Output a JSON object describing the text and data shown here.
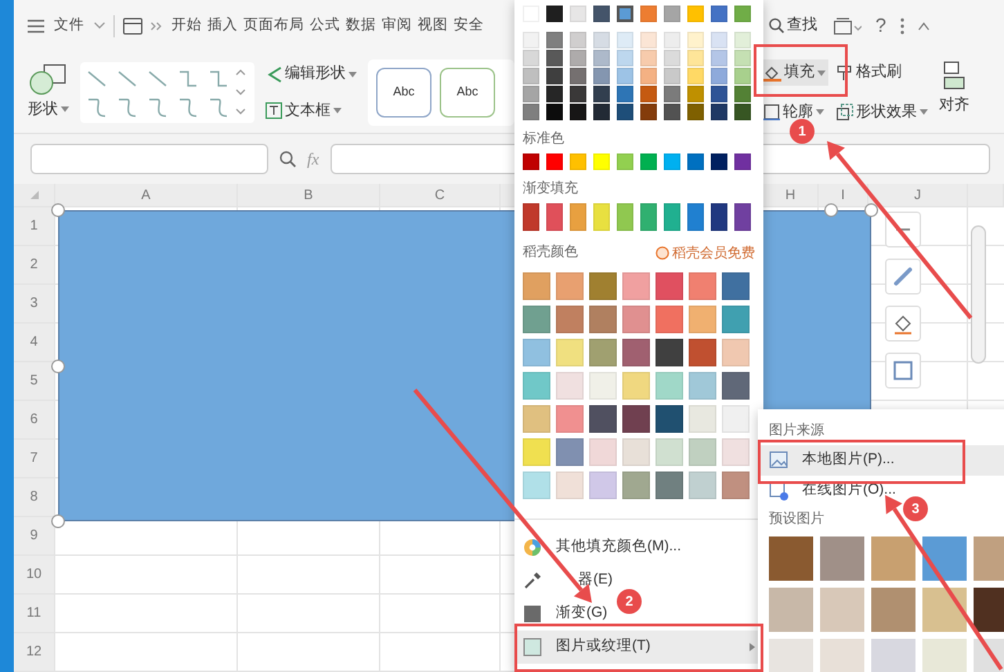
{
  "title_bar": {
    "menu_label": "文件",
    "tabs": [
      "开始",
      "插入",
      "页面布局",
      "公式",
      "数据",
      "审阅",
      "视图",
      "安全"
    ],
    "search_label": "查找",
    "help_label": "?"
  },
  "ribbon": {
    "shape_label": "形状",
    "edit_shape_label": "编辑形状",
    "text_box_label": "文本框",
    "style_presets": [
      "Abc",
      "Abc"
    ],
    "fill_label": "填充",
    "format_painter_label": "格式刷",
    "outline_label": "轮廓",
    "shape_effect_label": "形状效果",
    "align_label": "对齐"
  },
  "formula_bar": {
    "fx_label": "fx"
  },
  "sheet": {
    "columns": [
      "A",
      "B",
      "C",
      "H",
      "I",
      "J"
    ],
    "rows": [
      "1",
      "2",
      "3",
      "4",
      "5",
      "6",
      "7",
      "8",
      "9",
      "10",
      "11",
      "12"
    ]
  },
  "fill_menu": {
    "theme_colors": [
      {
        "color": "#ffffff",
        "selected": false
      },
      {
        "color": "#1f1f1f",
        "selected": false
      },
      {
        "color": "#e7e6e6",
        "selected": false
      },
      {
        "color": "#44546a",
        "selected": false
      },
      {
        "color": "#5b9bd5",
        "selected": true
      },
      {
        "color": "#ed7d31",
        "selected": false
      },
      {
        "color": "#a5a5a5",
        "selected": false
      },
      {
        "color": "#ffc000",
        "selected": false
      },
      {
        "color": "#4472c4",
        "selected": false
      },
      {
        "color": "#70ad47",
        "selected": false
      }
    ],
    "shade_rows": [
      [
        {
          "color": "#f2f2f2"
        },
        {
          "color": "#7f7f7f"
        },
        {
          "color": "#d0cece"
        },
        {
          "color": "#d6dce4"
        },
        {
          "color": "#deebf6"
        },
        {
          "color": "#fbe5d5"
        },
        {
          "color": "#ededed"
        },
        {
          "color": "#fff2cc"
        },
        {
          "color": "#d9e2f3"
        },
        {
          "color": "#e2efd9"
        }
      ],
      [
        {
          "color": "#d8d8d8"
        },
        {
          "color": "#595959"
        },
        {
          "color": "#aeabab"
        },
        {
          "color": "#adb9ca"
        },
        {
          "color": "#bdd7ee"
        },
        {
          "color": "#f7cbac"
        },
        {
          "color": "#dbdbdb"
        },
        {
          "color": "#fee599"
        },
        {
          "color": "#b4c6e7"
        },
        {
          "color": "#c5e0b3"
        }
      ],
      [
        {
          "color": "#bfbfbf"
        },
        {
          "color": "#3f3f3f"
        },
        {
          "color": "#757070"
        },
        {
          "color": "#8496b0"
        },
        {
          "color": "#9dc3e6"
        },
        {
          "color": "#f4b183"
        },
        {
          "color": "#c9c9c9"
        },
        {
          "color": "#ffd965"
        },
        {
          "color": "#8eaadb"
        },
        {
          "color": "#a8d08d"
        }
      ],
      [
        {
          "color": "#a5a5a5"
        },
        {
          "color": "#262626"
        },
        {
          "color": "#3a3838"
        },
        {
          "color": "#323f4f"
        },
        {
          "color": "#2e75b5"
        },
        {
          "color": "#c55a11"
        },
        {
          "color": "#7b7b7b"
        },
        {
          "color": "#bf9000"
        },
        {
          "color": "#2f5496"
        },
        {
          "color": "#538135"
        }
      ],
      [
        {
          "color": "#7f7f7f"
        },
        {
          "color": "#0c0c0c"
        },
        {
          "color": "#171616"
        },
        {
          "color": "#222a35"
        },
        {
          "color": "#1e4e79"
        },
        {
          "color": "#843c0b"
        },
        {
          "color": "#525252"
        },
        {
          "color": "#7f6000"
        },
        {
          "color": "#1f3864"
        },
        {
          "color": "#375623"
        }
      ]
    ],
    "standard_label": "标准色",
    "standard_colors": [
      {
        "color": "#c00000"
      },
      {
        "color": "#ff0000"
      },
      {
        "color": "#ffc000"
      },
      {
        "color": "#ffff00"
      },
      {
        "color": "#92d050"
      },
      {
        "color": "#00b050"
      },
      {
        "color": "#00b0f0"
      },
      {
        "color": "#0070c0"
      },
      {
        "color": "#002060"
      },
      {
        "color": "#7030a0"
      }
    ],
    "gradient_label": "渐变填充",
    "gradient_colors": [
      {
        "color": "#c0392b"
      },
      {
        "color": "#e0505a"
      },
      {
        "color": "#e8a040"
      },
      {
        "color": "#e8e040"
      },
      {
        "color": "#90c850"
      },
      {
        "color": "#30b070"
      },
      {
        "color": "#20b090"
      },
      {
        "color": "#2080d0"
      },
      {
        "color": "#203880"
      },
      {
        "color": "#7040a0"
      }
    ],
    "docer_label": "稻壳颜色",
    "docer_badge": "稻壳会员免费",
    "docer_colors": [
      {
        "color": "#e0a060"
      },
      {
        "color": "#e8a070"
      },
      {
        "color": "#a08030"
      },
      {
        "color": "#f0a0a0"
      },
      {
        "color": "#e05060"
      },
      {
        "color": "#f08070"
      },
      {
        "color": "#4070a0"
      },
      {
        "color": "#70a090"
      },
      {
        "color": "#c08060"
      },
      {
        "color": "#b08060"
      },
      {
        "color": "#e09090"
      },
      {
        "color": "#f07060"
      },
      {
        "color": "#f0b070"
      },
      {
        "color": "#40a0b0"
      },
      {
        "color": "#90c0e0"
      },
      {
        "color": "#f0e080"
      },
      {
        "color": "#a0a070"
      },
      {
        "color": "#a06070"
      },
      {
        "color": "#404040"
      },
      {
        "color": "#c05030"
      },
      {
        "color": "#f0c8b0"
      },
      {
        "color": "#70c8c8"
      },
      {
        "color": "#f0e0e0"
      },
      {
        "color": "#f0f0e8"
      },
      {
        "color": "#f0d880"
      },
      {
        "color": "#a0d8c8"
      },
      {
        "color": "#a0c8d8"
      },
      {
        "color": "#606878"
      },
      {
        "color": "#e0c080"
      },
      {
        "color": "#f09090"
      },
      {
        "color": "#505060"
      },
      {
        "color": "#704050"
      },
      {
        "color": "#205070"
      },
      {
        "color": "#e8e8e0"
      },
      {
        "color": "#f0f0f0"
      },
      {
        "color": "#f0e050"
      },
      {
        "color": "#8090b0"
      },
      {
        "color": "#f0d8d8"
      },
      {
        "color": "#e8e0d8"
      },
      {
        "color": "#d0e0d0"
      },
      {
        "color": "#c0d0c0"
      },
      {
        "color": "#f0e0e0"
      },
      {
        "color": "#b0e0e8"
      },
      {
        "color": "#f0e0d8"
      },
      {
        "color": "#d0c8e8"
      },
      {
        "color": "#a0a890"
      },
      {
        "color": "#708080"
      },
      {
        "color": "#c0d0d0"
      },
      {
        "color": "#c09080"
      }
    ],
    "items": [
      {
        "kind": "palette",
        "label": "其他填充颜色(M)...",
        "selected": false
      },
      {
        "kind": "eyedropper",
        "label": "器(E)",
        "selected": false
      },
      {
        "kind": "gradient",
        "label": "渐变(G)",
        "selected": false
      },
      {
        "kind": "picture",
        "label": "图片或纹理(T)",
        "selected": true
      }
    ]
  },
  "picture_submenu": {
    "source_label": "图片来源",
    "items": [
      {
        "kind": "local",
        "label": "本地图片(P)...",
        "selected": true
      },
      {
        "kind": "online",
        "label": "在线图片(O)...",
        "selected": false
      }
    ],
    "preset_label": "预设图片",
    "textures": [
      {
        "color": "#8a5a30"
      },
      {
        "color": "#a09088"
      },
      {
        "color": "#c8a070"
      },
      {
        "color": "#5b9bd5"
      },
      {
        "color": "#c0a080"
      },
      {
        "color": "#c8b8a8"
      },
      {
        "color": "#d8c8b8"
      },
      {
        "color": "#b09070"
      },
      {
        "color": "#d8c090"
      },
      {
        "color": "#503020"
      },
      {
        "color": "#e8e4e0"
      },
      {
        "color": "#e8e0d8"
      },
      {
        "color": "#d8d8e0"
      },
      {
        "color": "#e8e8d8"
      },
      {
        "color": "#e0e0e0"
      }
    ]
  },
  "annotations": [
    {
      "number": "1"
    },
    {
      "number": "2"
    },
    {
      "number": "3"
    }
  ]
}
